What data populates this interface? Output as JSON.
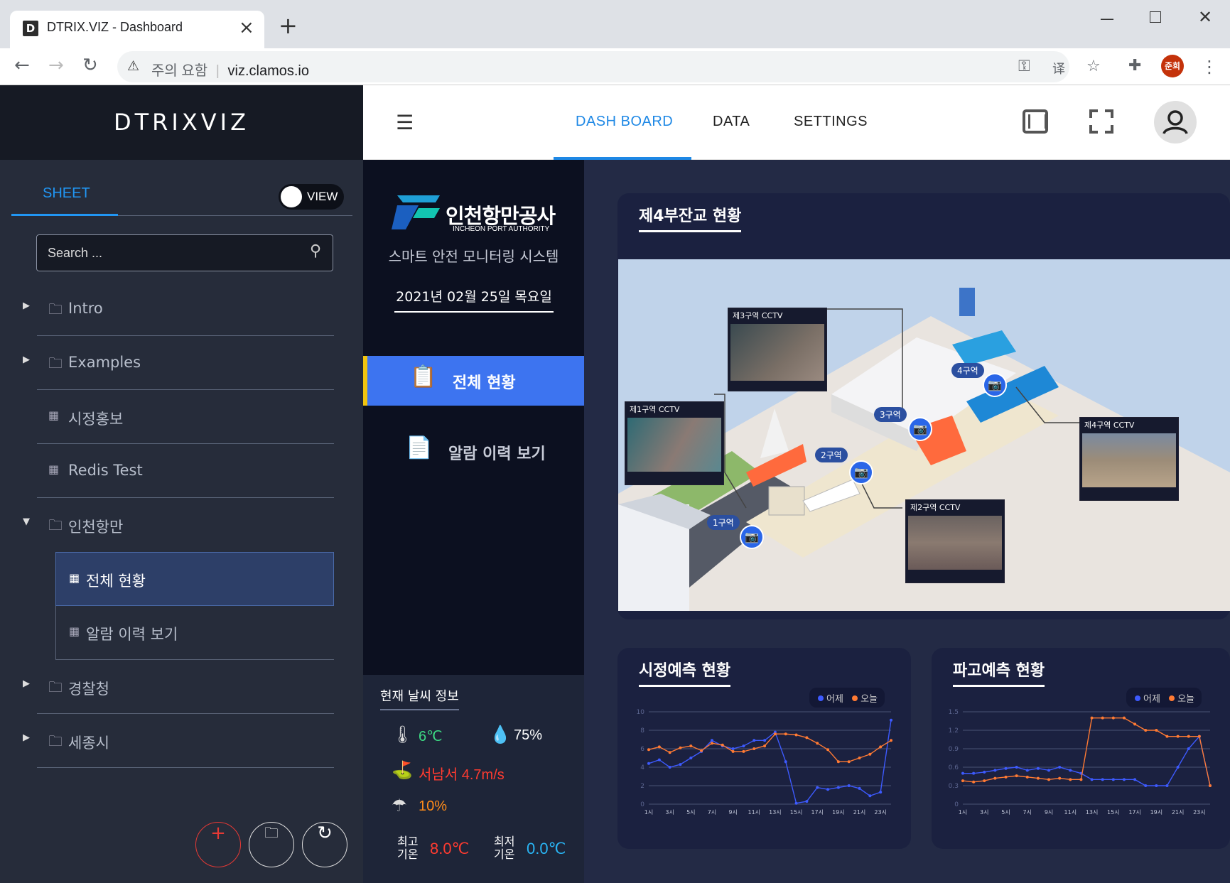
{
  "browser": {
    "tab_title": "DTRIX.VIZ - Dashboard",
    "favicon_letter": "D",
    "security_warning": "주의 요함",
    "url": "viz.clamos.io",
    "profile_label": "준희",
    "icons": [
      "back-arrow-icon",
      "forward-arrow-icon",
      "reload-icon",
      "warning-icon",
      "key-icon",
      "translate-icon",
      "star-icon",
      "extensions-icon",
      "menu-dots-icon"
    ]
  },
  "app": {
    "brand": "DTRIXVIZ",
    "nav": {
      "dashboard": "DASH BOARD",
      "data": "DATA",
      "settings": "SETTINGS"
    },
    "accent_color": "#1e88e5"
  },
  "sidebar": {
    "tab_sheet": "SHEET",
    "view_toggle": "VIEW",
    "search_placeholder": "Search ...",
    "tree": [
      {
        "label": "Intro",
        "type": "folder"
      },
      {
        "label": "Examples",
        "type": "folder"
      },
      {
        "label": "시정홍보",
        "type": "sheet"
      },
      {
        "label": "Redis Test",
        "type": "sheet"
      },
      {
        "label": "인천항만",
        "type": "folder-open"
      },
      {
        "label": "경찰청",
        "type": "folder"
      },
      {
        "label": "세종시",
        "type": "folder"
      }
    ],
    "children": [
      {
        "label": "전체 현황",
        "active": true
      },
      {
        "label": "알람 이력 보기",
        "active": false
      }
    ],
    "buttons": [
      "add-icon",
      "folder-icon",
      "refresh-icon"
    ]
  },
  "panel": {
    "logo_ko": "인천항만공사",
    "logo_en": "INCHEON PORT AUTHORITY",
    "system_title": "스마트 안전 모니터링 시스템",
    "date": "2021년 02월 25일 목요일",
    "menu": [
      {
        "label": "전체 현황",
        "active": true
      },
      {
        "label": "알람 이력 보기",
        "active": false
      }
    ]
  },
  "weather": {
    "title": "현재 날씨 정보",
    "temperature": "6℃",
    "humidity": "75%",
    "wind": "서남서 4.7m/s",
    "precip": "10%",
    "max_label": "최고\n기온",
    "max_value": "8.0℃",
    "min_label": "최저\n기온",
    "min_value": "0.0℃",
    "colors": {
      "temp": "#3ddc84",
      "wind": "#ff3b30",
      "precip": "#ff8c1a",
      "max": "#ff3b30",
      "min": "#29b6f6"
    }
  },
  "map_card": {
    "title": "제4부잔교 현황",
    "cctv": [
      "제3구역 CCTV",
      "제1구역 CCTV",
      "제4구역 CCTV",
      "제2구역 CCTV"
    ],
    "zones": [
      "1구역",
      "2구역",
      "3구역",
      "4구역"
    ]
  },
  "chart_cards": {
    "visibility_title": "시정예측 현황",
    "wave_title": "파고예측 현황",
    "legend_yesterday": "어제",
    "legend_today": "오늘"
  },
  "chart_data": [
    {
      "type": "line",
      "title": "시정예측 현황",
      "x": [
        "1시",
        "2시",
        "3시",
        "4시",
        "5시",
        "6시",
        "7시",
        "8시",
        "9시",
        "10시",
        "11시",
        "12시",
        "13시",
        "14시",
        "15시",
        "16시",
        "17시",
        "18시",
        "19시",
        "20시",
        "21시",
        "22시",
        "23시",
        "24시"
      ],
      "x_tick_labels": [
        "1시",
        "3시",
        "5시",
        "7시",
        "9시",
        "11시",
        "13시",
        "15시",
        "17시",
        "19시",
        "21시",
        "23시"
      ],
      "ylim": [
        0,
        10
      ],
      "y_ticks": [
        0,
        2,
        4,
        6,
        8,
        10
      ],
      "series": [
        {
          "name": "어제",
          "color": "#3d5afe",
          "values": [
            4.4,
            4.8,
            4.0,
            4.3,
            5.0,
            5.7,
            6.9,
            6.3,
            6.0,
            6.3,
            6.9,
            6.9,
            7.8,
            4.6,
            0.1,
            0.3,
            1.8,
            1.6,
            1.8,
            2.0,
            1.7,
            0.9,
            1.3,
            9.1
          ]
        },
        {
          "name": "오늘",
          "color": "#ff7a33",
          "values": [
            5.9,
            6.2,
            5.6,
            6.1,
            6.3,
            5.8,
            6.6,
            6.4,
            5.7,
            5.7,
            6.0,
            6.3,
            7.6,
            7.6,
            7.5,
            7.2,
            6.6,
            5.9,
            4.6,
            4.6,
            5.0,
            5.4,
            6.2,
            6.9
          ]
        }
      ],
      "grid": true,
      "legend": "top-right"
    },
    {
      "type": "line",
      "title": "파고예측 현황",
      "x": [
        "1시",
        "2시",
        "3시",
        "4시",
        "5시",
        "6시",
        "7시",
        "8시",
        "9시",
        "10시",
        "11시",
        "12시",
        "13시",
        "14시",
        "15시",
        "16시",
        "17시",
        "18시",
        "19시",
        "20시",
        "21시",
        "22시",
        "23시",
        "24시"
      ],
      "x_tick_labels": [
        "1시",
        "3시",
        "5시",
        "7시",
        "9시",
        "11시",
        "13시",
        "15시",
        "17시",
        "19시",
        "21시",
        "23시"
      ],
      "ylim": [
        0,
        1.5
      ],
      "y_ticks": [
        0,
        0.3,
        0.6,
        0.9,
        1.2,
        1.5
      ],
      "series": [
        {
          "name": "어제",
          "color": "#3d5afe",
          "values": [
            0.5,
            0.5,
            0.52,
            0.55,
            0.58,
            0.6,
            0.55,
            0.58,
            0.55,
            0.6,
            0.55,
            0.5,
            0.4,
            0.4,
            0.4,
            0.4,
            0.4,
            0.3,
            0.3,
            0.3,
            0.6,
            0.9,
            1.1,
            0.3
          ]
        },
        {
          "name": "오늘",
          "color": "#ff7a33",
          "values": [
            0.38,
            0.36,
            0.38,
            0.42,
            0.44,
            0.46,
            0.44,
            0.42,
            0.4,
            0.42,
            0.4,
            0.4,
            1.4,
            1.4,
            1.4,
            1.4,
            1.3,
            1.2,
            1.2,
            1.1,
            1.1,
            1.1,
            1.1,
            0.3
          ]
        }
      ],
      "grid": true,
      "legend": "top-right"
    }
  ]
}
